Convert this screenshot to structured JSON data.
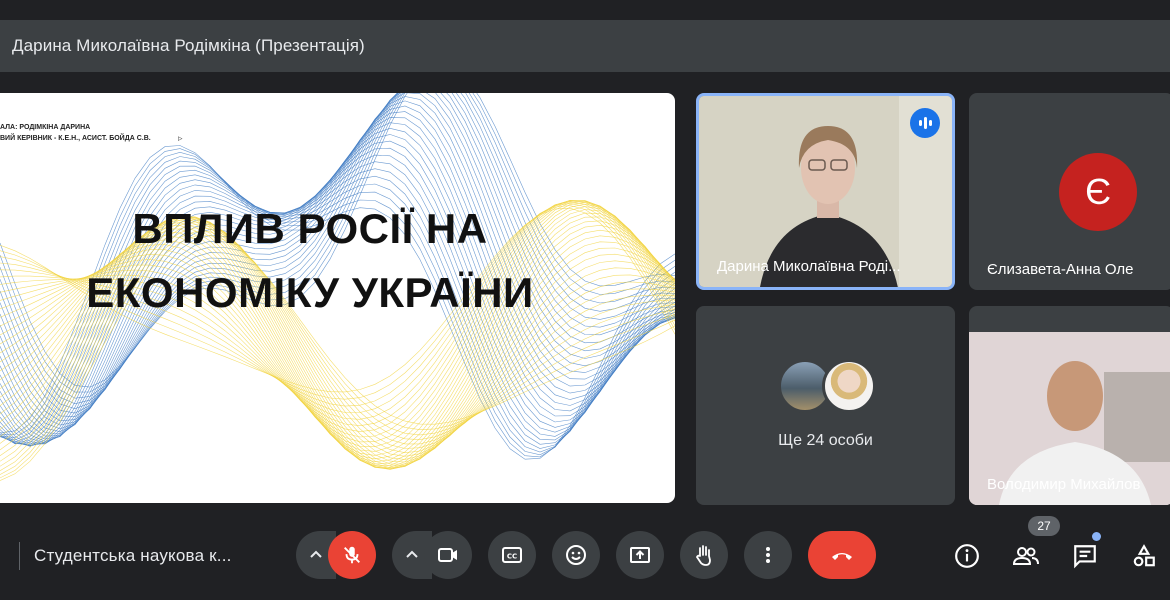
{
  "presenter_bar": {
    "title": "Дарина Миколаївна Родімкіна (Презентація)"
  },
  "slide": {
    "meta_line1": "АЛА: РОДІМКІНА ДАРИНА",
    "meta_line2": "ВИЙ КЕРІВНИК - К.Е.Н., АСИСТ. БОЙДА С.В.",
    "title_line1": "ВПЛИВ РОСІЇ НА",
    "title_line2": "ЕКОНОМІКУ УКРАЇНИ"
  },
  "tiles": {
    "speaker_name": "Дарина Миколаївна Роді...",
    "e_initial": "Є",
    "e_name": "Єлизавета-Анна Оле",
    "more_label": "Ще 24 особи",
    "v_name": "Володимир Михайлов"
  },
  "bottom_bar": {
    "meeting_name": "Студентська наукова к...",
    "participants_count": "27"
  },
  "colors": {
    "background": "#202124",
    "tile": "#3c4043",
    "accent_blue": "#8ab4f8",
    "danger_red": "#ea4335",
    "avatar_e": "#c5221f",
    "wave_blue": "#3b78c2",
    "wave_yellow": "#f2d33c"
  },
  "icons": [
    "speaking-icon",
    "chevron-up-icon",
    "mic-off-icon",
    "camera-icon",
    "captions-icon",
    "emoji-icon",
    "present-icon",
    "raise-hand-icon",
    "more-vert-icon",
    "call-end-icon",
    "info-icon",
    "people-icon",
    "chat-icon",
    "activities-icon"
  ]
}
